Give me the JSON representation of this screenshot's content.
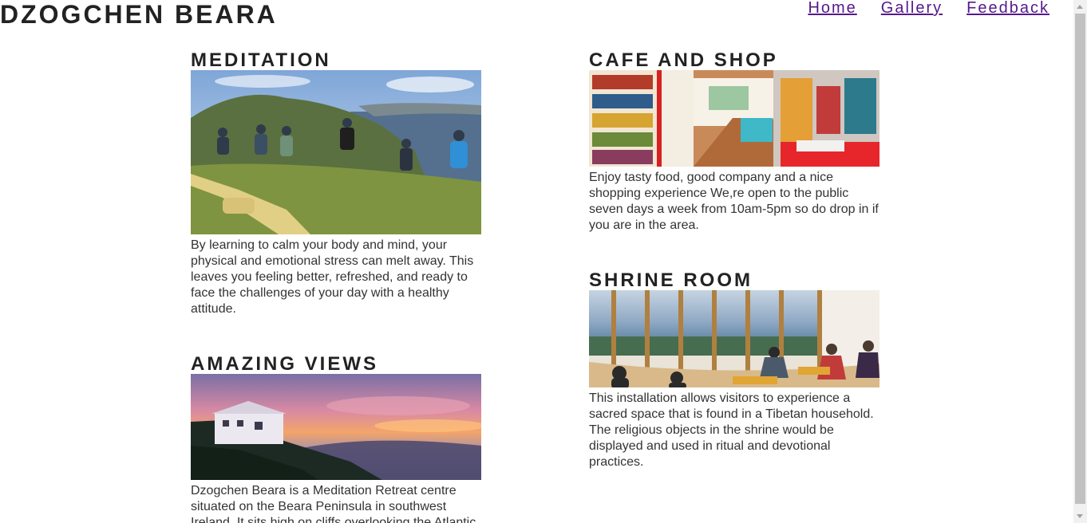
{
  "header": {
    "site_title": "DZOGCHEN BEARA",
    "nav": [
      "Home",
      "Gallery",
      "Feedback"
    ]
  },
  "sections": {
    "meditation": {
      "title": "MEDITATION",
      "image_alt": "Group meditating on a grassy cliff overlooking the sea",
      "text": "By learning to calm your body and mind, your physical and emotional stress can melt away. This leaves you feeling better, refreshed, and ready to face the challenges of your day with a healthy attitude."
    },
    "views": {
      "title": "AMAZING VIEWS",
      "image_alt": "House on a hillside at sunset above the sea",
      "text": "Dzogchen Beara is a Meditation Retreat centre situated on the Beara Peninsula in southwest Ireland. It sits high on cliffs overlooking the Atlantic"
    },
    "cafe": {
      "title": "CAFE AND SHOP",
      "image_alt": "Interior of the cafe and shop with bookshelves",
      "text": "Enjoy tasty food, good company and a nice shopping experience We,re open to the public seven days a week from 10am-5pm so do drop in if you are in the area."
    },
    "shrine": {
      "title": "SHRINE ROOM",
      "image_alt": "People seated in the shrine room facing large windows onto the ocean",
      "text": "This installation allows visitors to experience a sacred space that is found in a Tibetan household. The religious objects in the shrine would be displayed and used in ritual and devotional practices."
    }
  },
  "colors": {
    "heading": "#222222",
    "body_text": "#333333",
    "nav_link": "#551a8b"
  }
}
